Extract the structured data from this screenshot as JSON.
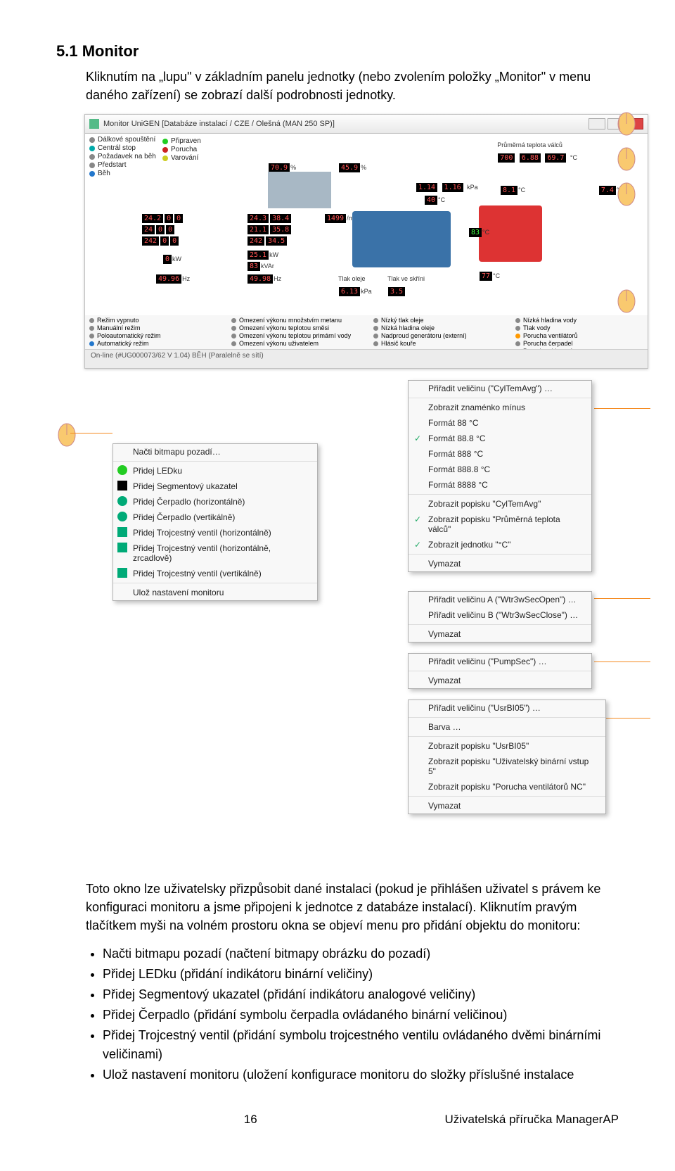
{
  "heading": "5.1  Monitor",
  "intro": "Kliknutím na „lupu\" v základním panelu jednotky (nebo zvolením položky „Monitor\" v menu daného zařízení) se zobrazí další podrobnosti jednotky.",
  "window_title": "Monitor UniGEN [Databáze instalací / CZE / Olešná (MAN 250 SP)]",
  "left_leds": [
    {
      "color": "g",
      "label": "Připraven"
    },
    {
      "color": "r",
      "label": "Porucha"
    },
    {
      "color": "y",
      "label": "Varování"
    }
  ],
  "left_leds2": [
    {
      "color": "gr",
      "label": "Dálkové spouštění"
    },
    {
      "color": "t",
      "label": "Centrál stop"
    },
    {
      "color": "gr",
      "label": "Požadavek na běh"
    },
    {
      "color": "gr",
      "label": "Předstart"
    },
    {
      "color": "b",
      "label": "Běh"
    }
  ],
  "top_right_label": "Průměrná teplota válců",
  "readouts": {
    "a": "700",
    "b": "6.88",
    "c": "69.7",
    "unit_c": "°C",
    "pct1": "70.9",
    "pct2": "45.9",
    "kpa1": "1.14",
    "kpa2": "1.16",
    "kpa_u": "kPa",
    "t1": "40",
    "t2": "8.1",
    "t3": "7.4",
    "v1": "24.2",
    "v2": "0",
    "v3": "0",
    "v4": "24.3",
    "v5": "38.4",
    "rpm": "1499",
    "v6": "24",
    "v7": "0",
    "v8": "0",
    "v9": "21.1",
    "v10": "35.8",
    "v11": "242",
    "v12": "0",
    "v13": "0",
    "v14": "242",
    "v15": "34.5",
    "kw": "0",
    "kw2": "25.1",
    "kvar": "83",
    "hz": "49.96",
    "hz2": "49.98",
    "oil1": "6.13",
    "oil2": "3.5",
    "oil1_l": "Tlak oleje",
    "oil2_l": "Tlak ve skříni",
    "oil_u": "kPa",
    "t4": "77",
    "t5": "83"
  },
  "bottom_cols": [
    [
      {
        "c": "gr",
        "t": "Režim vypnuto"
      },
      {
        "c": "gr",
        "t": "Manuální režim"
      },
      {
        "c": "gr",
        "t": "Poloautomatický režim"
      },
      {
        "c": "b",
        "t": "Automatický režim"
      }
    ],
    [
      {
        "c": "gr",
        "t": "Omezení výkonu množstvím metanu"
      },
      {
        "c": "gr",
        "t": "Omezení výkonu teplotou směsi"
      },
      {
        "c": "gr",
        "t": "Omezení výkonu teplotou primární vody"
      },
      {
        "c": "gr",
        "t": "Omezení výkonu uživatelem"
      }
    ],
    [
      {
        "c": "gr",
        "t": "Nízký tlak oleje"
      },
      {
        "c": "gr",
        "t": "Nízká hladina oleje"
      },
      {
        "c": "gr",
        "t": "Nadproud generátoru (externí)"
      },
      {
        "c": "gr",
        "t": "Hlásič kouře"
      }
    ],
    [
      {
        "c": "gr",
        "t": "Nízká hladina vody"
      },
      {
        "c": "gr",
        "t": "Tlak vody"
      },
      {
        "c": "o",
        "t": "Porucha ventilátorů"
      },
      {
        "c": "gr",
        "t": "Porucha čerpadel"
      },
      {
        "c": "gr",
        "t": "Porucha chlazení"
      }
    ]
  ],
  "statusbar": "On-line (#UG000073/62  V 1.04)            BĚH (Paralelně se sítí)",
  "menu_left": {
    "items": [
      {
        "t": "Načti bitmapu pozadí…",
        "icon": ""
      },
      {
        "hr": true
      },
      {
        "t": "Přidej LEDku",
        "icon": "led"
      },
      {
        "t": "Přidej Segmentový ukazatel",
        "icon": "seg"
      },
      {
        "t": "Přidej Čerpadlo (horizontálně)",
        "icon": "pump"
      },
      {
        "t": "Přidej Čerpadlo (vertikálně)",
        "icon": "pump"
      },
      {
        "t": "Přidej Trojcestný ventil (horizontálně)",
        "icon": "valve"
      },
      {
        "t": "Přidej Trojcestný ventil (horizontálně, zrcadlově)",
        "icon": "valve"
      },
      {
        "t": "Přidej Trojcestný ventil (vertikálně)",
        "icon": "valve"
      },
      {
        "hr": true
      },
      {
        "t": "Ulož nastavení monitoru",
        "icon": ""
      }
    ]
  },
  "menu_temp": {
    "items": [
      {
        "t": "Přiřadit veličinu (\"CylTemAvg\") …"
      },
      {
        "hr": true
      },
      {
        "t": "Zobrazit znaménko mínus"
      },
      {
        "t": "Formát 88 °C"
      },
      {
        "t": "Formát 88.8 °C",
        "check": true
      },
      {
        "t": "Formát 888 °C"
      },
      {
        "t": "Formát 888.8 °C"
      },
      {
        "t": "Formát 8888 °C"
      },
      {
        "hr": true
      },
      {
        "t": "Zobrazit popisku \"CylTemAvg\""
      },
      {
        "t": "Zobrazit popisku \"Průměrná teplota válců\"",
        "check": true
      },
      {
        "t": "Zobrazit jednotku \"°C\"",
        "check": true
      },
      {
        "hr": true
      },
      {
        "t": "Vymazat"
      }
    ]
  },
  "menu_valve": {
    "items": [
      {
        "t": "Přiřadit veličinu A (\"Wtr3wSecOpen\") …"
      },
      {
        "t": "Přiřadit veličinu B (\"Wtr3wSecClose\") …"
      },
      {
        "hr": true
      },
      {
        "t": "Vymazat"
      }
    ]
  },
  "menu_pump": {
    "items": [
      {
        "t": "Přiřadit veličinu (\"PumpSec\") …"
      },
      {
        "hr": true
      },
      {
        "t": "Vymazat"
      }
    ]
  },
  "menu_usr": {
    "items": [
      {
        "t": "Přiřadit veličinu (\"UsrBI05\") …"
      },
      {
        "hr": true
      },
      {
        "t": "Barva …"
      },
      {
        "hr": true
      },
      {
        "t": "Zobrazit popisku \"UsrBI05\""
      },
      {
        "t": "Zobrazit popisku \"Uživatelský binární vstup 5\""
      },
      {
        "t": "Zobrazit popisku \"Porucha ventilátorů NC\""
      },
      {
        "hr": true
      },
      {
        "t": "Vymazat"
      }
    ]
  },
  "para2_a": "Toto okno lze uživatelsky přizpůsobit dané instalaci (pokud je přihlášen uživatel s právem ke konfiguraci monitoru a jsme připojeni k jednotce z databáze instalací).",
  "para2_b": "Kliknutím pravým tlačítkem myši na volném prostoru okna se objeví menu pro přidání objektu do monitoru:",
  "bullets": [
    "Načti bitmapu pozadí (načtení bitmapy obrázku do pozadí)",
    "Přidej LEDku (přidání indikátoru binární veličiny)",
    "Přidej Segmentový ukazatel (přidání indikátoru analogové veličiny)",
    "Přidej Čerpadlo (přidání symbolu čerpadla ovládaného binární veličinou)",
    "Přidej Trojcestný ventil (přidání symbolu trojcestného ventilu ovládaného dvěmi binárními veličinami)",
    "Ulož nastavení monitoru (uložení konfigurace monitoru do složky příslušné instalace"
  ],
  "footer_page": "16",
  "footer_right": "Uživatelská příručka ManagerAP"
}
